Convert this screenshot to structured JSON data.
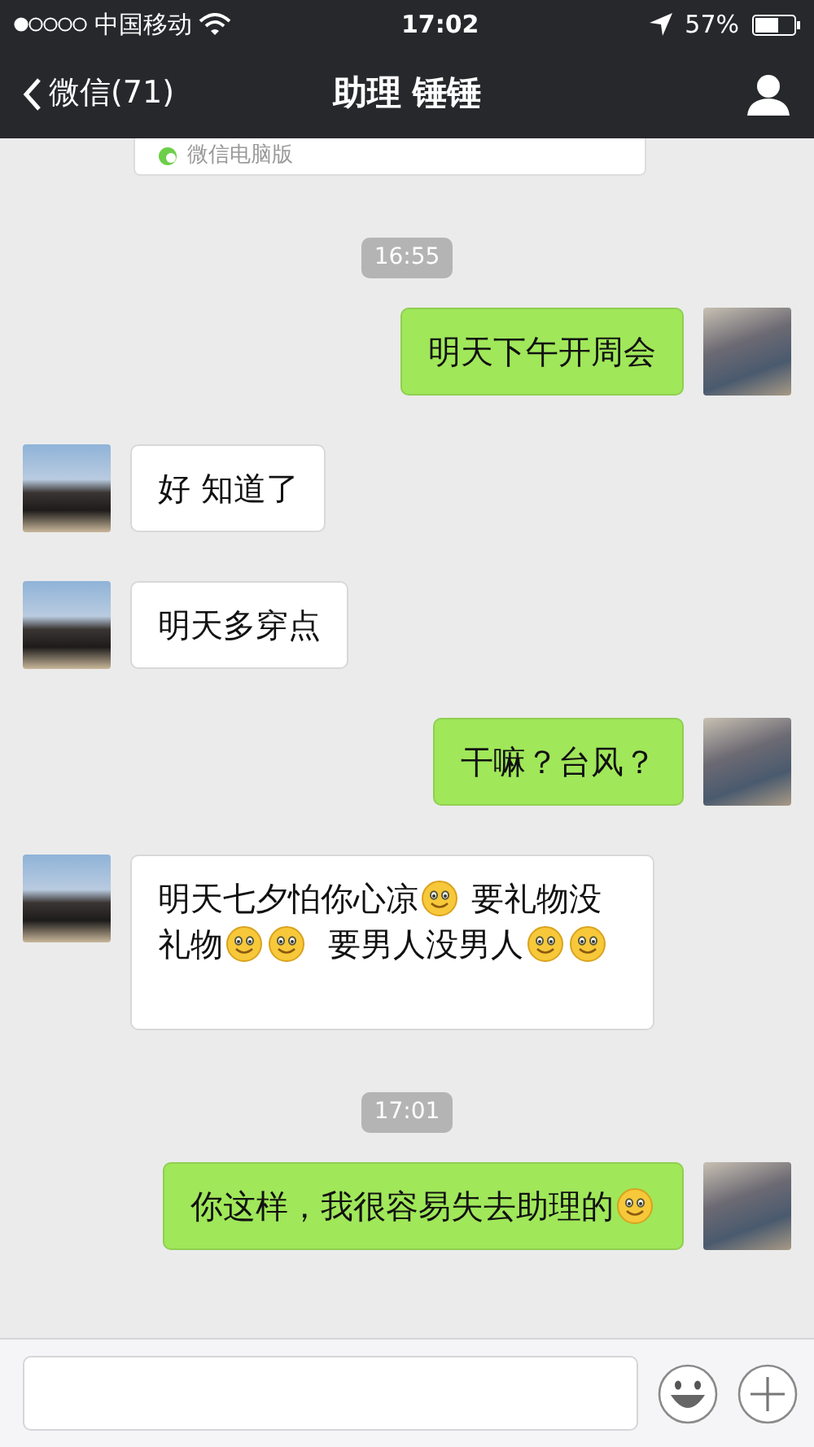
{
  "status_bar": {
    "carrier": "中国移动",
    "time": "17:02",
    "battery": "57%"
  },
  "nav": {
    "back_label": "微信(71)",
    "title": "助理 锤锤"
  },
  "pinned_notice": {
    "text": "微信电脑版"
  },
  "messages": [
    {
      "kind": "time",
      "text": "16:55"
    },
    {
      "kind": "message",
      "outgoing": true,
      "parts": [
        {
          "kind": "text",
          "text": "明天下午开周会"
        }
      ]
    },
    {
      "kind": "message",
      "outgoing": false,
      "parts": [
        {
          "kind": "text",
          "text": "好 知道了"
        }
      ]
    },
    {
      "kind": "message",
      "outgoing": false,
      "parts": [
        {
          "kind": "text",
          "text": "明天多穿点"
        }
      ]
    },
    {
      "kind": "message",
      "outgoing": true,
      "parts": [
        {
          "kind": "text",
          "text": "干嘛？台风？"
        }
      ]
    },
    {
      "kind": "message",
      "outgoing": false,
      "parts": [
        {
          "kind": "text",
          "text": "明天七夕怕你心凉"
        },
        {
          "kind": "emoji"
        },
        {
          "kind": "text",
          "text": " 要礼物没礼物"
        },
        {
          "kind": "emoji"
        },
        {
          "kind": "emoji"
        },
        {
          "kind": "text",
          "text": "  要男人没男人"
        },
        {
          "kind": "emoji"
        },
        {
          "kind": "emoji"
        }
      ]
    },
    {
      "kind": "time",
      "text": "17:01"
    },
    {
      "kind": "message",
      "outgoing": true,
      "parts": [
        {
          "kind": "text",
          "text": "你这样，我很容易失去助理的"
        },
        {
          "kind": "emoji"
        }
      ]
    }
  ]
}
